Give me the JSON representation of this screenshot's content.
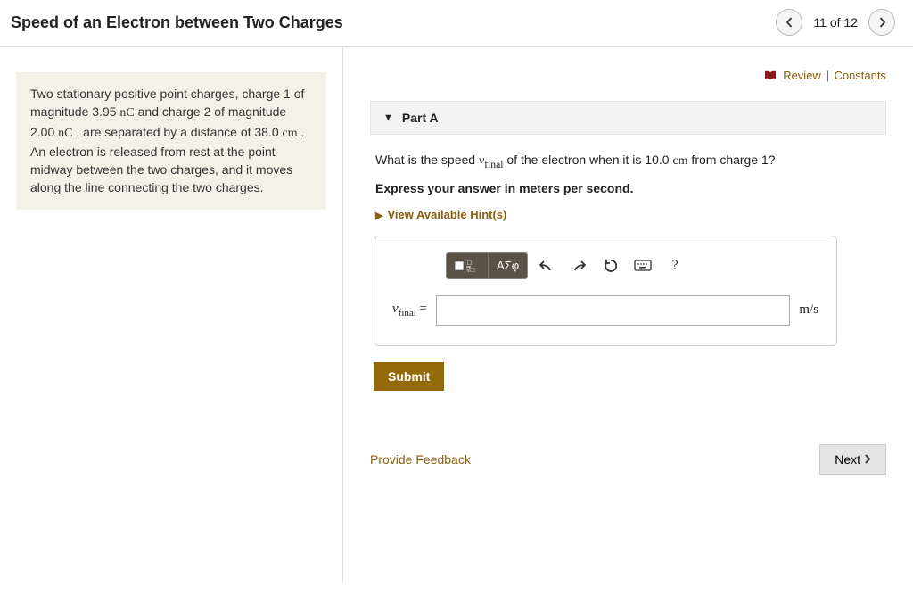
{
  "header": {
    "title": "Speed of an Electron between Two Charges",
    "nav_count": "11 of 12"
  },
  "problem": {
    "text_pre1": "Two stationary positive point charges, charge 1 of magnitude 3.95 ",
    "unit1": "nC",
    "text_mid1": " and charge 2 of magnitude 2.00 ",
    "unit2": "nC",
    "text_mid2": " , are separated by a distance of 38.0 ",
    "unit3": "cm",
    "text_post": " . An electron is released from rest at the point midway between the two charges, and it moves along the line connecting the two charges."
  },
  "toplinks": {
    "review": "Review",
    "constants": "Constants"
  },
  "partA": {
    "label": "Part A",
    "question_pre": "What is the speed ",
    "var": "v",
    "sub": "final",
    "question_mid": " of the electron when it is 10.0 ",
    "unit": "cm",
    "question_post": " from charge 1?",
    "instruction": "Express your answer in meters per second.",
    "hints": "View Available Hint(s)",
    "toolbar": {
      "greek": "ΑΣφ"
    },
    "answer": {
      "var": "v",
      "sub": "final",
      "eq": " = ",
      "value": "",
      "unit": "m/s"
    },
    "submit": "Submit"
  },
  "bottom": {
    "feedback": "Provide Feedback",
    "next": "Next"
  }
}
